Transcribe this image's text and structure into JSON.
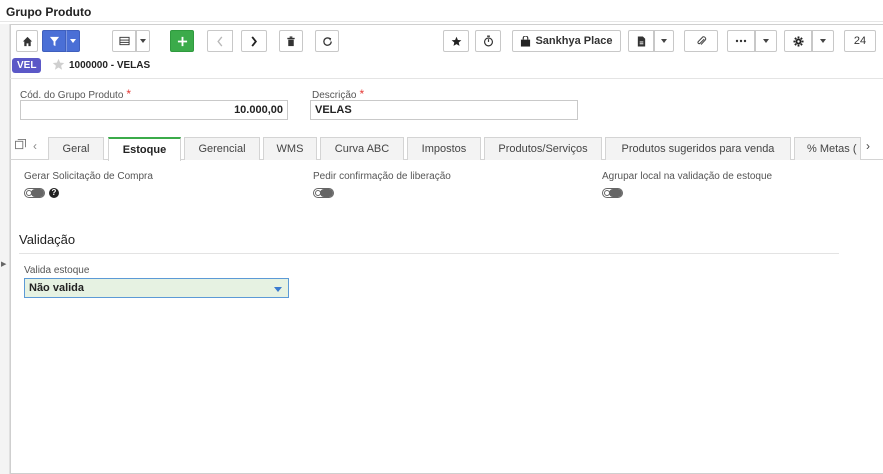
{
  "window": {
    "title": "Grupo Produto"
  },
  "toolbar": {
    "place_label": "Sankhya Place",
    "counter": "24"
  },
  "record": {
    "badge": "VEL",
    "name": "1000000 - VELAS"
  },
  "form": {
    "code_label": "Cód. do Grupo Produto",
    "code_value": "10.000,00",
    "desc_label": "Descrição",
    "desc_value": "VELAS",
    "required_mark": "*"
  },
  "tabs": [
    {
      "label": "Geral"
    },
    {
      "label": "Estoque",
      "active": true
    },
    {
      "label": "Gerencial"
    },
    {
      "label": "WMS"
    },
    {
      "label": "Curva ABC"
    },
    {
      "label": "Impostos"
    },
    {
      "label": "Produtos/Serviços"
    },
    {
      "label": "Produtos sugeridos para venda"
    },
    {
      "label": "% Metas ("
    }
  ],
  "estoque": {
    "gerar_label": "Gerar Solicitação de Compra",
    "pedir_label": "Pedir confirmação de liberação",
    "agrupar_label": "Agrupar local na validação de estoque",
    "help": "?",
    "section_title": "Validação",
    "valida_label": "Valida estoque",
    "valida_value": "Não valida"
  },
  "colors": {
    "accent_blue": "#4a6fd6",
    "accent_green": "#3bab4a",
    "badge": "#5b58c7"
  }
}
